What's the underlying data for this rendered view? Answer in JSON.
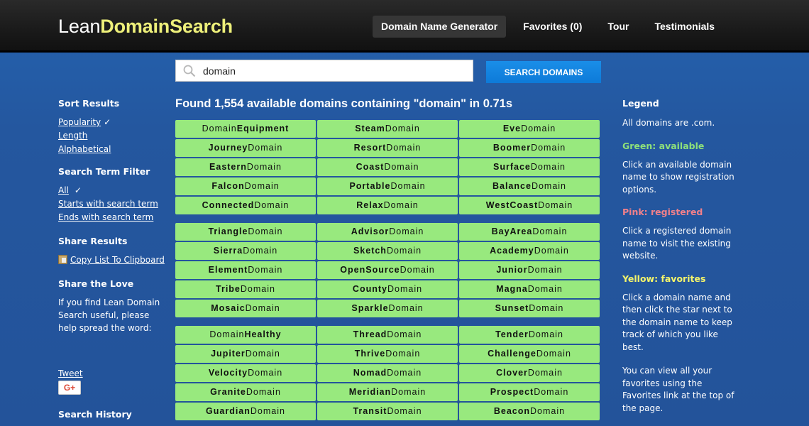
{
  "header": {
    "logo_part1": "Lean",
    "logo_part2": "DomainSearch",
    "nav": [
      {
        "label": "Domain Name Generator",
        "active": true
      },
      {
        "label": "Favorites (0)",
        "active": false
      },
      {
        "label": "Tour",
        "active": false
      },
      {
        "label": "Testimonials",
        "active": false
      }
    ]
  },
  "search": {
    "value": "domain",
    "icon": "search-icon",
    "button_label": "SEARCH DOMAINS"
  },
  "results": {
    "title": "Found 1,554 available domains containing \"domain\" in 0.71s",
    "cell_color": "#98e97e",
    "groups": [
      [
        {
          "pre": "Domain",
          "bold": "Equipment",
          "post": "",
          "boldFirst": false
        },
        {
          "pre": "",
          "bold": "Steam",
          "post": "Domain"
        },
        {
          "pre": "",
          "bold": "Eve",
          "post": "Domain"
        },
        {
          "pre": "",
          "bold": "Journey",
          "post": "Domain"
        },
        {
          "pre": "",
          "bold": "Resort",
          "post": "Domain"
        },
        {
          "pre": "",
          "bold": "Boomer",
          "post": "Domain"
        },
        {
          "pre": "",
          "bold": "Eastern",
          "post": "Domain"
        },
        {
          "pre": "",
          "bold": "Coast",
          "post": "Domain"
        },
        {
          "pre": "",
          "bold": "Surface",
          "post": "Domain"
        },
        {
          "pre": "",
          "bold": "Falcon",
          "post": "Domain"
        },
        {
          "pre": "",
          "bold": "Portable",
          "post": "Domain"
        },
        {
          "pre": "",
          "bold": "Balance",
          "post": "Domain"
        },
        {
          "pre": "",
          "bold": "Connected",
          "post": "Domain"
        },
        {
          "pre": "",
          "bold": "Relax",
          "post": "Domain"
        },
        {
          "pre": "",
          "bold": "WestCoast",
          "post": "Domain"
        }
      ],
      [
        {
          "pre": "",
          "bold": "Triangle",
          "post": "Domain"
        },
        {
          "pre": "",
          "bold": "Advisor",
          "post": "Domain"
        },
        {
          "pre": "",
          "bold": "BayArea",
          "post": "Domain"
        },
        {
          "pre": "",
          "bold": "Sierra",
          "post": "Domain"
        },
        {
          "pre": "",
          "bold": "Sketch",
          "post": "Domain"
        },
        {
          "pre": "",
          "bold": "Academy",
          "post": "Domain"
        },
        {
          "pre": "",
          "bold": "Element",
          "post": "Domain"
        },
        {
          "pre": "",
          "bold": "OpenSource",
          "post": "Domain"
        },
        {
          "pre": "",
          "bold": "Junior",
          "post": "Domain"
        },
        {
          "pre": "",
          "bold": "Tribe",
          "post": "Domain"
        },
        {
          "pre": "",
          "bold": "County",
          "post": "Domain"
        },
        {
          "pre": "",
          "bold": "Magna",
          "post": "Domain"
        },
        {
          "pre": "",
          "bold": "Mosaic",
          "post": "Domain"
        },
        {
          "pre": "",
          "bold": "Sparkle",
          "post": "Domain"
        },
        {
          "pre": "",
          "bold": "Sunset",
          "post": "Domain"
        }
      ],
      [
        {
          "pre": "Domain",
          "bold": "Healthy",
          "post": ""
        },
        {
          "pre": "",
          "bold": "Thread",
          "post": "Domain"
        },
        {
          "pre": "",
          "bold": "Tender",
          "post": "Domain"
        },
        {
          "pre": "",
          "bold": "Jupiter",
          "post": "Domain"
        },
        {
          "pre": "",
          "bold": "Thrive",
          "post": "Domain"
        },
        {
          "pre": "",
          "bold": "Challenge",
          "post": "Domain"
        },
        {
          "pre": "",
          "bold": "Velocity",
          "post": "Domain"
        },
        {
          "pre": "",
          "bold": "Nomad",
          "post": "Domain"
        },
        {
          "pre": "",
          "bold": "Clover",
          "post": "Domain"
        },
        {
          "pre": "",
          "bold": "Granite",
          "post": "Domain"
        },
        {
          "pre": "",
          "bold": "Meridian",
          "post": "Domain"
        },
        {
          "pre": "",
          "bold": "Prospect",
          "post": "Domain"
        },
        {
          "pre": "",
          "bold": "Guardian",
          "post": "Domain"
        },
        {
          "pre": "",
          "bold": "Transit",
          "post": "Domain"
        },
        {
          "pre": "",
          "bold": "Beacon",
          "post": "Domain"
        }
      ]
    ]
  },
  "sidebar": {
    "sort_heading": "Sort Results",
    "sort_options": [
      {
        "label": "Popularity",
        "checked": true
      },
      {
        "label": "Length",
        "checked": false
      },
      {
        "label": "Alphabetical",
        "checked": false
      }
    ],
    "filter_heading": "Search Term Filter",
    "filter_options": [
      {
        "label": "All",
        "checked": true
      },
      {
        "label": "Starts with search term",
        "checked": false
      },
      {
        "label": "Ends with search term",
        "checked": false
      }
    ],
    "check_mark": "✓",
    "share_heading": "Share Results",
    "copy_label": "Copy List To Clipboard",
    "love_heading": "Share the Love",
    "love_text": "If you find Lean Domain Search useful, please help spread the word:",
    "tweet_label": "Tweet",
    "gplus_label": "G+",
    "history_heading": "Search History"
  },
  "legend": {
    "heading": "Legend",
    "all_com": "All domains are .com.",
    "green_label": "Green: available",
    "green_color": "#8ee07a",
    "green_text": "Click an available domain name to show registration options.",
    "pink_label": "Pink: registered",
    "pink_color": "#f2808a",
    "pink_text": "Click a registered domain name to visit the existing website.",
    "yellow_label": "Yellow: favorites",
    "yellow_color": "#f5f56a",
    "yellow_text": "Click a domain name and then click the star next to the domain name to keep track of which you like best.",
    "favorites_text": "You can view all your favorites using the Favorites link at the top of the page."
  }
}
